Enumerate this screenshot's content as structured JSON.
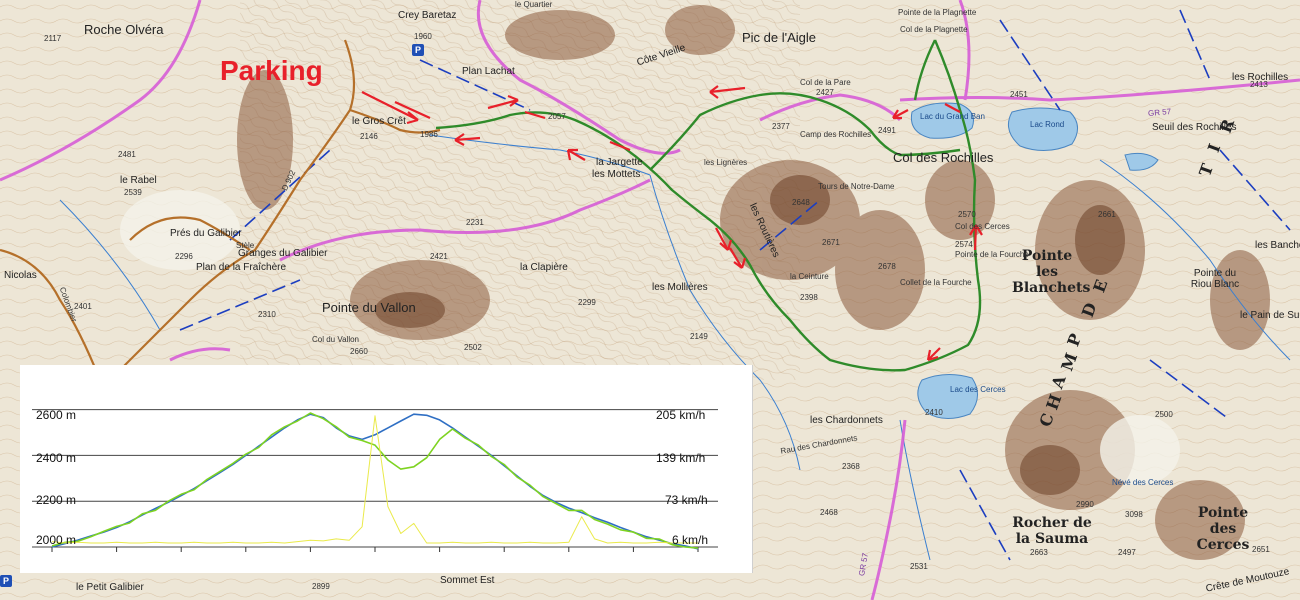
{
  "map": {
    "parking_label": "Parking",
    "parking_signs": [
      "P",
      "P"
    ],
    "big_labels": [
      "Roche Olvéra",
      "Pic de l'Aigle",
      "Col des Rochilles",
      "Pointe du Vallon",
      "Pointe les Blanchets",
      "Rocher de la Sauma",
      "Pointe des Cerces",
      "Pointe du Riou Blanc"
    ],
    "place_labels": [
      "Crey Baretaz",
      "Plan Lachat",
      "le Gros Crêt",
      "la Jargette",
      "les Mottets",
      "les Lignères",
      "Côte Vieille",
      "Col de la Plagnette",
      "Pointe de la Plagnette",
      "Camp des Rochilles",
      "Tours de Notre-Dame",
      "la Ceinture",
      "Collet de la Fourche",
      "Pointe de la Fourche",
      "Col des Cerces",
      "les Rochilles",
      "Seuil des Rochilles",
      "Lac Rond",
      "Lac du Grand Ban",
      "Lac des Cerces",
      "les Chardonnets",
      "la Clapière",
      "les Mollières",
      "Prés du Galibier",
      "Granges du Galibier",
      "Plan de la Fraîchère",
      "le Rabel",
      "Col du Vallon",
      "Nicolas",
      "Colombier",
      "le Petit Galibier",
      "Sommet Est",
      "Crête de Moutouze",
      "les Banche",
      "le Pain de Sucre",
      "Névé des Cerces",
      "le Quartier",
      "Col de la Pare",
      "Stèle",
      "Rau des Chardonnets",
      "les Routières"
    ],
    "altitudes": [
      "2117",
      "1960",
      "1986",
      "2146",
      "2057",
      "2377",
      "2427",
      "2491",
      "2451",
      "2481",
      "2539",
      "2296",
      "2401",
      "2310",
      "2421",
      "2299",
      "2502",
      "2660",
      "2648",
      "2671",
      "2678",
      "2398",
      "2570",
      "2574",
      "2410",
      "2368",
      "2468",
      "2661",
      "2990",
      "2663",
      "3098",
      "2497",
      "2651",
      "2899",
      "2413",
      "2531",
      "2231",
      "2149",
      "2500"
    ],
    "range_letters": [
      "C",
      "H",
      "A",
      "M",
      "P",
      "D",
      "E",
      "T",
      "I",
      "R"
    ],
    "road_labels": [
      "D 902",
      "GR 57",
      "GR 57"
    ]
  },
  "profile": {
    "elevation_axis": [
      "2600 m",
      "2400 m",
      "2200 m",
      "2000 m"
    ],
    "speed_axis": [
      "205 km/h",
      "139 km/h",
      "73 km/h",
      "6 km/h"
    ]
  },
  "chart_data": {
    "type": "line",
    "y_elevation_ticks": [
      2000,
      2200,
      2400,
      2600
    ],
    "ylim_elevation": [
      2000,
      2620
    ],
    "y_speed_ticks": [
      6,
      73,
      139,
      205
    ],
    "ylim_speed": [
      0,
      211
    ],
    "x": [
      0,
      2,
      4,
      6,
      8,
      10,
      12,
      14,
      16,
      18,
      20,
      22,
      24,
      26,
      28,
      30,
      32,
      34,
      36,
      38,
      40,
      42,
      44,
      46,
      48,
      50,
      52,
      54,
      56,
      58,
      60,
      62,
      64,
      66,
      68,
      70,
      72,
      74,
      76,
      78,
      80,
      82,
      84,
      86,
      88,
      90,
      92,
      94,
      96,
      98,
      100
    ],
    "xlim": [
      0,
      100
    ],
    "series": [
      {
        "color": "#2f6fc4",
        "values": [
          2000,
          2015,
          2030,
          2048,
          2065,
          2085,
          2110,
          2140,
          2168,
          2195,
          2225,
          2255,
          2290,
          2325,
          2360,
          2400,
          2440,
          2480,
          2520,
          2555,
          2580,
          2565,
          2520,
          2485,
          2470,
          2490,
          2520,
          2550,
          2580,
          2575,
          2555,
          2520,
          2480,
          2440,
          2400,
          2355,
          2310,
          2265,
          2225,
          2195,
          2170,
          2150,
          2128,
          2108,
          2085,
          2065,
          2045,
          2030,
          2015,
          2005,
          1992
        ]
      },
      {
        "color": "#7ed321",
        "values": [
          2005,
          2020,
          2025,
          2045,
          2068,
          2090,
          2105,
          2145,
          2160,
          2200,
          2230,
          2250,
          2295,
          2330,
          2365,
          2405,
          2435,
          2490,
          2525,
          2550,
          2585,
          2560,
          2525,
          2480,
          2465,
          2445,
          2380,
          2340,
          2350,
          2390,
          2470,
          2515,
          2475,
          2445,
          2395,
          2360,
          2305,
          2270,
          2220,
          2190,
          2160,
          2160,
          2120,
          2100,
          2075,
          2065,
          2038,
          2035,
          2010,
          2000,
          1995
        ]
      },
      {
        "color": "#eaea4a",
        "values": [
          8,
          6,
          7,
          6,
          6,
          7,
          6,
          6,
          7,
          6,
          6,
          7,
          6,
          6,
          7,
          6,
          6,
          7,
          6,
          8,
          10,
          9,
          12,
          10,
          30,
          195,
          60,
          20,
          35,
          6,
          6,
          7,
          6,
          6,
          7,
          6,
          6,
          7,
          6,
          6,
          7,
          45,
          12,
          6,
          7,
          6,
          6,
          7,
          6,
          6,
          6
        ]
      }
    ]
  }
}
